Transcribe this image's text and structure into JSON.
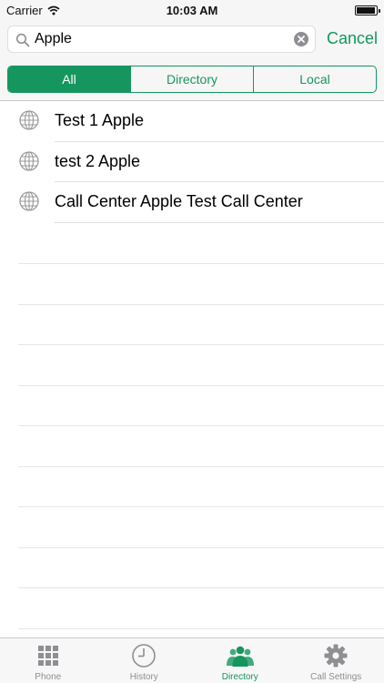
{
  "status_bar": {
    "carrier": "Carrier",
    "time": "10:03 AM"
  },
  "search": {
    "value": "Apple",
    "cancel_label": "Cancel"
  },
  "segments": [
    {
      "label": "All",
      "active": true
    },
    {
      "label": "Directory",
      "active": false
    },
    {
      "label": "Local",
      "active": false
    }
  ],
  "results": [
    {
      "name": "Test 1 Apple",
      "icon": "globe-icon"
    },
    {
      "name": "test 2 Apple",
      "icon": "globe-icon"
    },
    {
      "name": "Call Center Apple Test Call Center",
      "icon": "globe-icon"
    }
  ],
  "tabbar": [
    {
      "label": "Phone",
      "icon": "keypad-icon",
      "active": false
    },
    {
      "label": "History",
      "icon": "clock-icon",
      "active": false
    },
    {
      "label": "Directory",
      "icon": "people-icon",
      "active": true
    },
    {
      "label": "Call Settings",
      "icon": "gear-icon",
      "active": false
    }
  ],
  "colors": {
    "accent": "#15965e",
    "inactive": "#8e8e93"
  }
}
